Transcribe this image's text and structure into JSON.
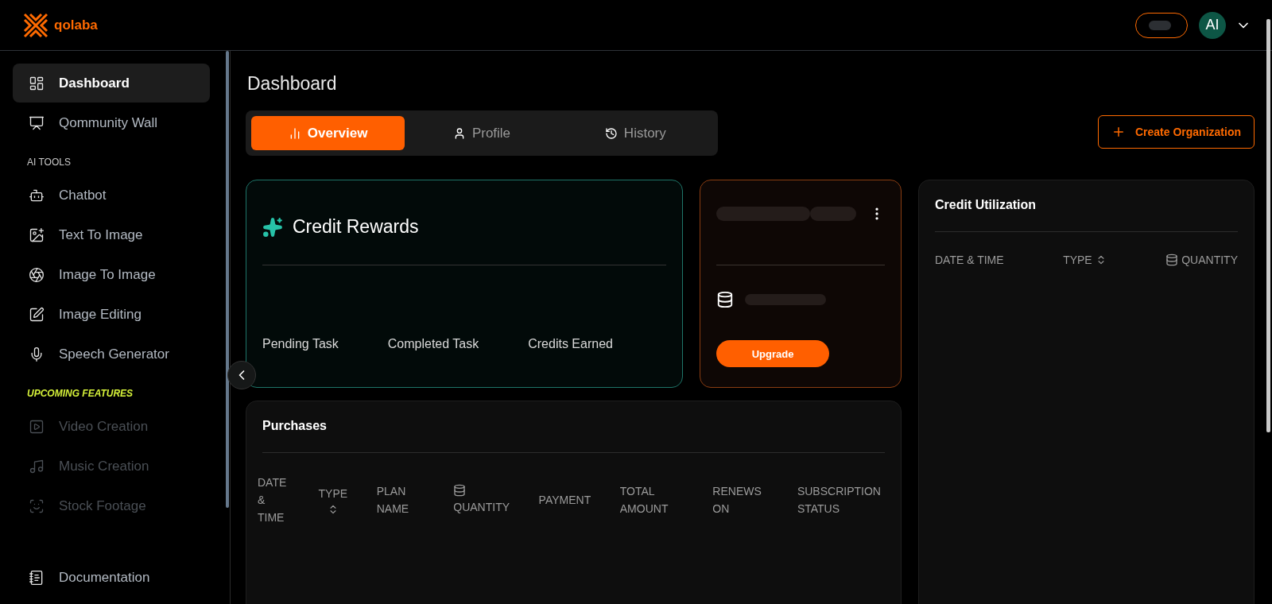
{
  "header": {
    "logo_text": "qolaba",
    "avatar": "AI",
    "toggle": {
      "on": false
    }
  },
  "sidebar": {
    "items": [
      {
        "label": "Dashboard",
        "kind": "dashboard",
        "selected": true,
        "disabled": false
      },
      {
        "label": "Qommunity Wall",
        "kind": "community",
        "selected": false,
        "disabled": false
      }
    ],
    "sections": [
      {
        "title": "AI TOOLS",
        "kind": "tools",
        "items": [
          {
            "label": "Chatbot",
            "kind": "bot",
            "selected": false,
            "disabled": false
          },
          {
            "label": "Text To Image",
            "kind": "text-image",
            "selected": false,
            "disabled": false
          },
          {
            "label": "Image To Image",
            "kind": "aperture",
            "selected": false,
            "disabled": false
          },
          {
            "label": "Image Editing",
            "kind": "edit",
            "selected": false,
            "disabled": false
          },
          {
            "label": "Speech Generator",
            "kind": "speech",
            "selected": false,
            "disabled": false
          }
        ]
      },
      {
        "title": "UPCOMING FEATURES",
        "kind": "upcoming",
        "items": [
          {
            "label": "Video Creation",
            "kind": "video",
            "selected": false,
            "disabled": true
          },
          {
            "label": "Music Creation",
            "kind": "music",
            "selected": false,
            "disabled": true
          },
          {
            "label": "Stock Footage",
            "kind": "footage",
            "selected": false,
            "disabled": true
          }
        ]
      }
    ],
    "bottom_items": [
      {
        "label": "Documentation",
        "kind": "docs",
        "selected": false,
        "disabled": false
      }
    ]
  },
  "page": {
    "title": "Dashboard",
    "create_button": "Create Organization"
  },
  "tabs": [
    {
      "label": "Overview",
      "kind": "chart",
      "selected": true
    },
    {
      "label": "Profile",
      "kind": "user",
      "selected": false
    },
    {
      "label": "History",
      "kind": "history",
      "selected": false
    }
  ],
  "credit_rewards": {
    "title": "Credit Rewards",
    "stats": [
      "Pending Task",
      "Completed Task",
      "Credits Earned"
    ]
  },
  "plan_card": {
    "button": "Upgrade"
  },
  "credit_utilization": {
    "title": "Credit Utilization",
    "columns": [
      {
        "label": "DATE & TIME",
        "kind": "plain"
      },
      {
        "label": "TYPE",
        "kind": "sortable"
      },
      {
        "label": "QUANTITY",
        "kind": "credits"
      }
    ]
  },
  "purchases": {
    "title": "Purchases",
    "columns": [
      {
        "label": "DATE & TIME",
        "kind": "plain"
      },
      {
        "label": "TYPE",
        "kind": "sortable"
      },
      {
        "label": "PLAN NAME",
        "kind": "plain"
      },
      {
        "label": "QUANTITY",
        "kind": "credits"
      },
      {
        "label": "PAYMENT",
        "kind": "plain"
      },
      {
        "label": "TOTAL AMOUNT",
        "kind": "plain"
      },
      {
        "label": "RENEWS ON",
        "kind": "plain"
      },
      {
        "label": "SUBSCRIPTION STATUS",
        "kind": "plain"
      }
    ]
  }
}
